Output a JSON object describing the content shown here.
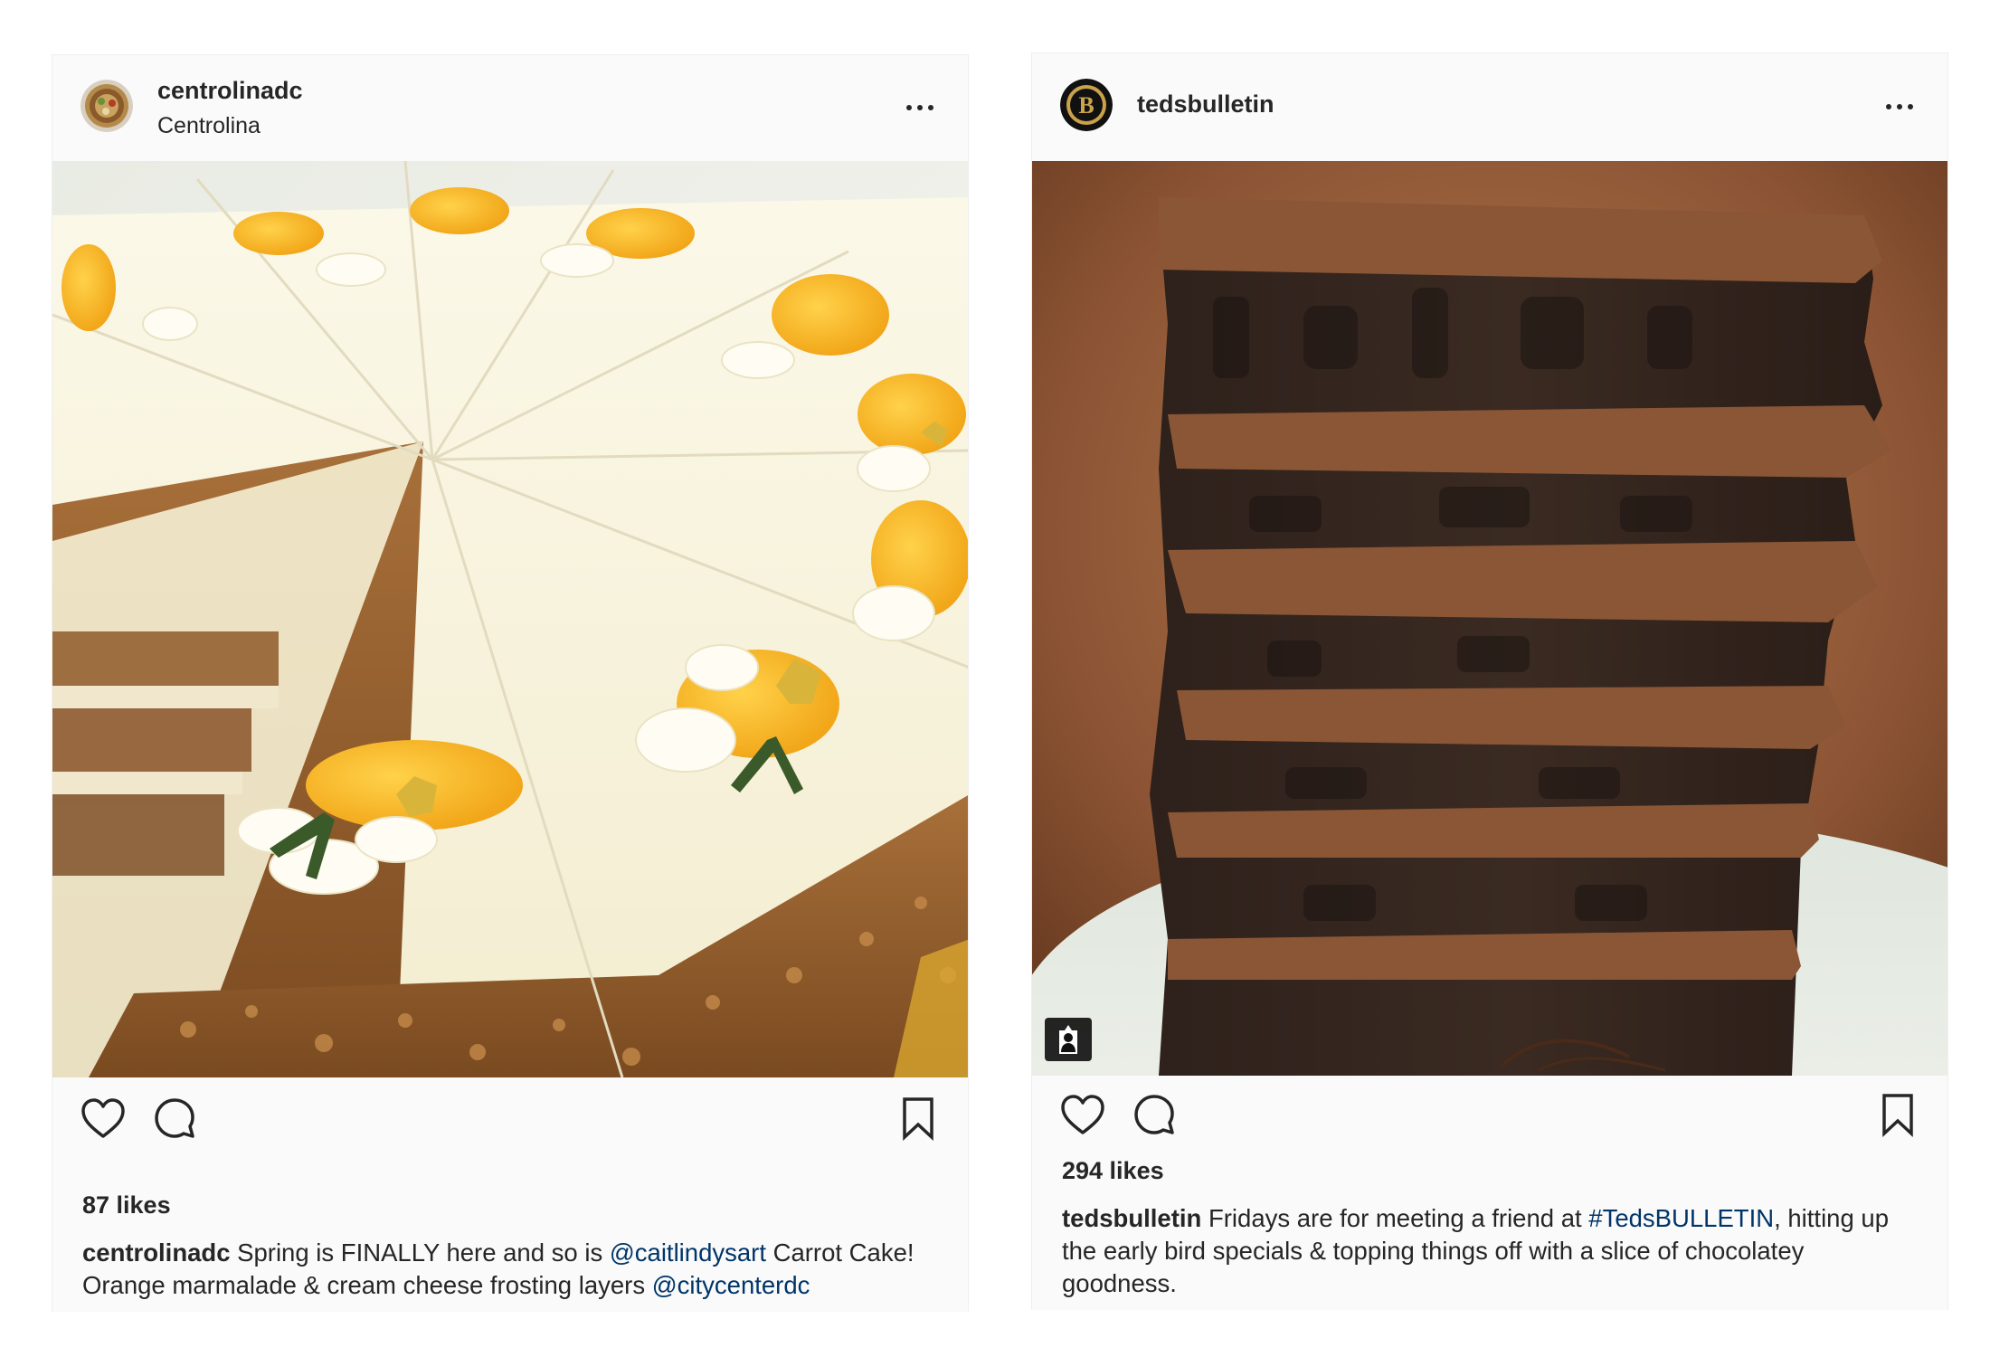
{
  "posts": [
    {
      "username": "centrolinadc",
      "location": "Centrolina",
      "likes": "87 likes",
      "caption": {
        "user": "centrolinadc",
        "text_1": " Spring is FINALLY here and so is ",
        "mention_1": "@caitlindysart",
        "text_2": " Carrot Cake! Orange marmalade & cream cheese frosting layers ",
        "mention_2": "@citycenterdc"
      },
      "icons": {
        "more": "more-options-icon",
        "like": "heart-icon",
        "comment": "comment-icon",
        "save": "bookmark-icon"
      }
    },
    {
      "username": "tedsbulletin",
      "likes": "294 likes",
      "caption": {
        "user": "tedsbulletin",
        "text_1": " Fridays are for meeting a friend at ",
        "hashtag": "#TedsBULLETIN",
        "text_2": ", hitting up the early bird specials & topping things off with a slice of chocolatey goodness."
      },
      "icons": {
        "more": "more-options-icon",
        "like": "heart-icon",
        "comment": "comment-icon",
        "save": "bookmark-icon",
        "tag": "user-tag-icon"
      }
    }
  ],
  "colors": {
    "card_background": "#fafafa",
    "text": "#262626",
    "link": "#003569",
    "border": "#efefef"
  }
}
